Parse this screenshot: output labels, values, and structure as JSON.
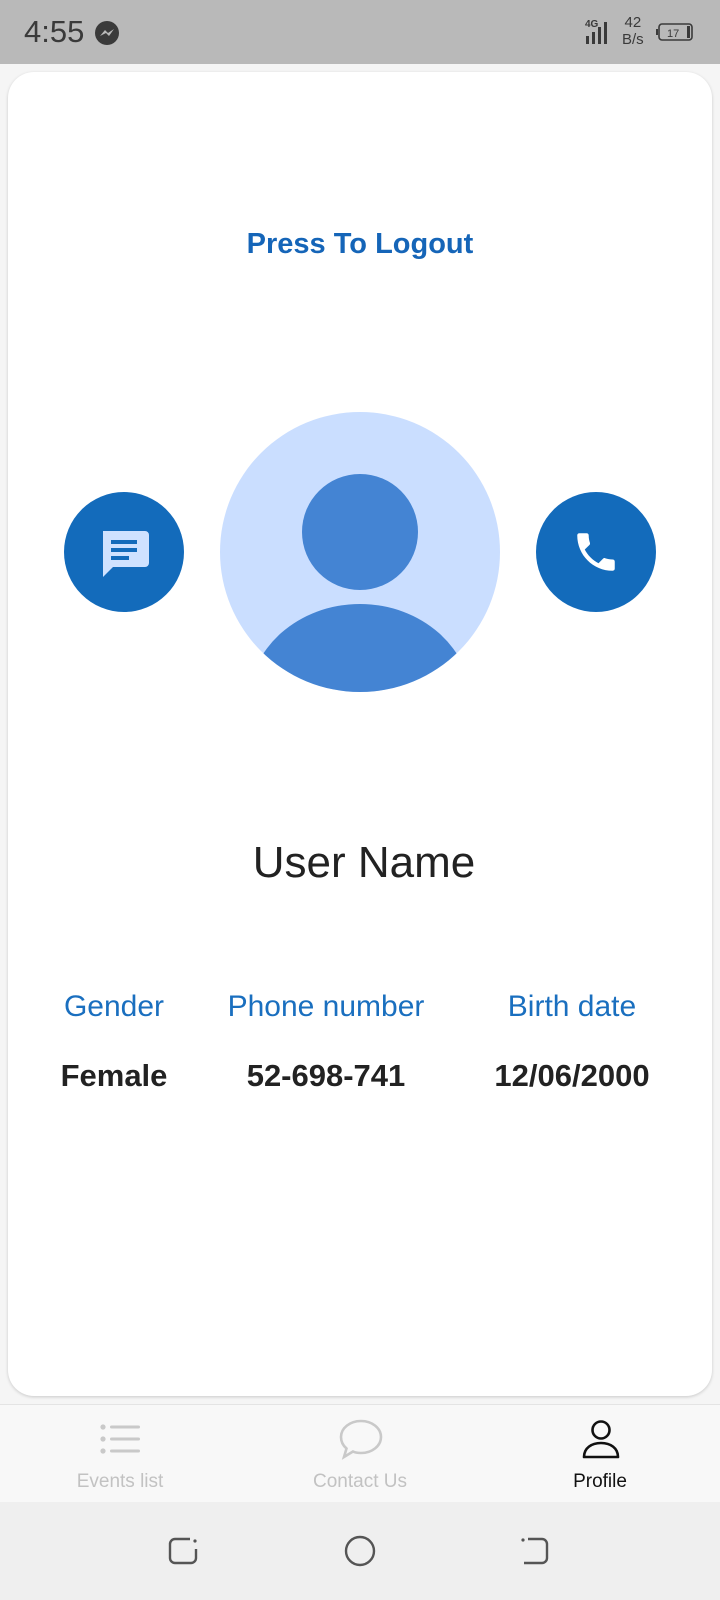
{
  "status_bar": {
    "time": "4:55",
    "network_type": "4G",
    "speed_value": "42",
    "speed_unit": "B/s",
    "battery": "17",
    "icons": [
      "messenger-icon",
      "signal-icon",
      "battery-icon"
    ]
  },
  "profile": {
    "logout_label": "Press To Logout",
    "user_name": "User Name",
    "chat_icon": "chat-bubble-icon",
    "call_icon": "phone-icon",
    "avatar_icon": "person-avatar-icon",
    "fields": [
      {
        "label": "Gender",
        "value": "Female"
      },
      {
        "label": "Phone number",
        "value": "52-698-741"
      },
      {
        "label": "Birth date",
        "value": "12/06/2000"
      }
    ]
  },
  "bottom_nav": {
    "items": [
      {
        "label": "Events list",
        "icon": "list-icon",
        "active": false
      },
      {
        "label": "Contact Us",
        "icon": "speech-bubble-icon",
        "active": false
      },
      {
        "label": "Profile",
        "icon": "person-icon",
        "active": true
      }
    ]
  },
  "system_nav": {
    "icons": [
      "recents-icon",
      "home-icon",
      "back-icon"
    ]
  },
  "colors": {
    "accent": "#1565b8",
    "button_fill": "#136bbb",
    "avatar_bg": "#cadeff",
    "avatar_fg": "#4484d3",
    "status_bar": "#b9b9b9"
  }
}
